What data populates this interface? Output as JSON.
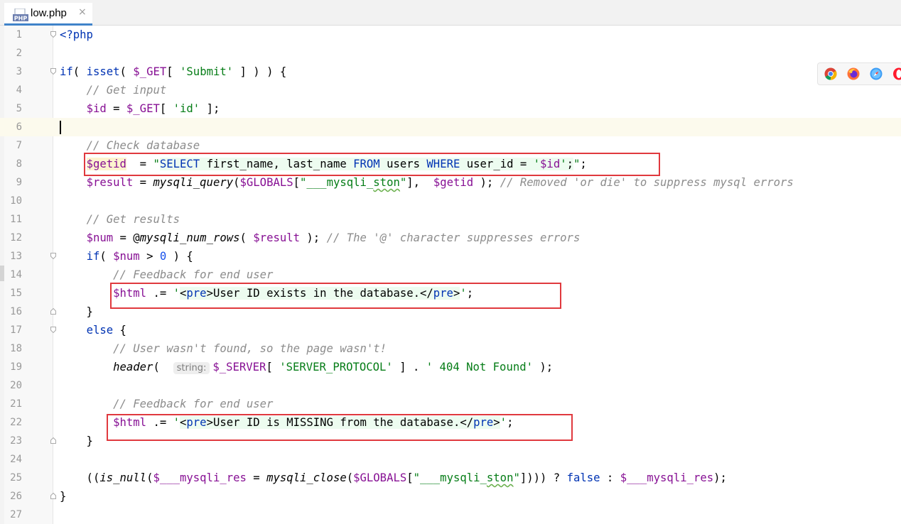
{
  "tab": {
    "label": "low.php",
    "close": "×",
    "icon_text": "PHP"
  },
  "hint_string": "string:",
  "lines": [
    {
      "n": "1"
    },
    {
      "n": "2"
    },
    {
      "n": "3"
    },
    {
      "n": "4"
    },
    {
      "n": "5"
    },
    {
      "n": "6"
    },
    {
      "n": "7"
    },
    {
      "n": "8"
    },
    {
      "n": "9"
    },
    {
      "n": "10"
    },
    {
      "n": "11"
    },
    {
      "n": "12"
    },
    {
      "n": "13"
    },
    {
      "n": "14"
    },
    {
      "n": "15"
    },
    {
      "n": "16"
    },
    {
      "n": "17"
    },
    {
      "n": "18"
    },
    {
      "n": "19"
    },
    {
      "n": "20"
    },
    {
      "n": "21"
    },
    {
      "n": "22"
    },
    {
      "n": "23"
    },
    {
      "n": "24"
    },
    {
      "n": "25"
    },
    {
      "n": "26"
    },
    {
      "n": "27"
    }
  ],
  "browser_icons": [
    "chrome-icon",
    "firefox-icon",
    "safari-icon",
    "opera-icon"
  ],
  "colors": {
    "keyword": "#0033b3",
    "variable": "#871094",
    "string": "#067d17",
    "comment": "#8c8c8c",
    "annotation_box": "#e0393e"
  }
}
